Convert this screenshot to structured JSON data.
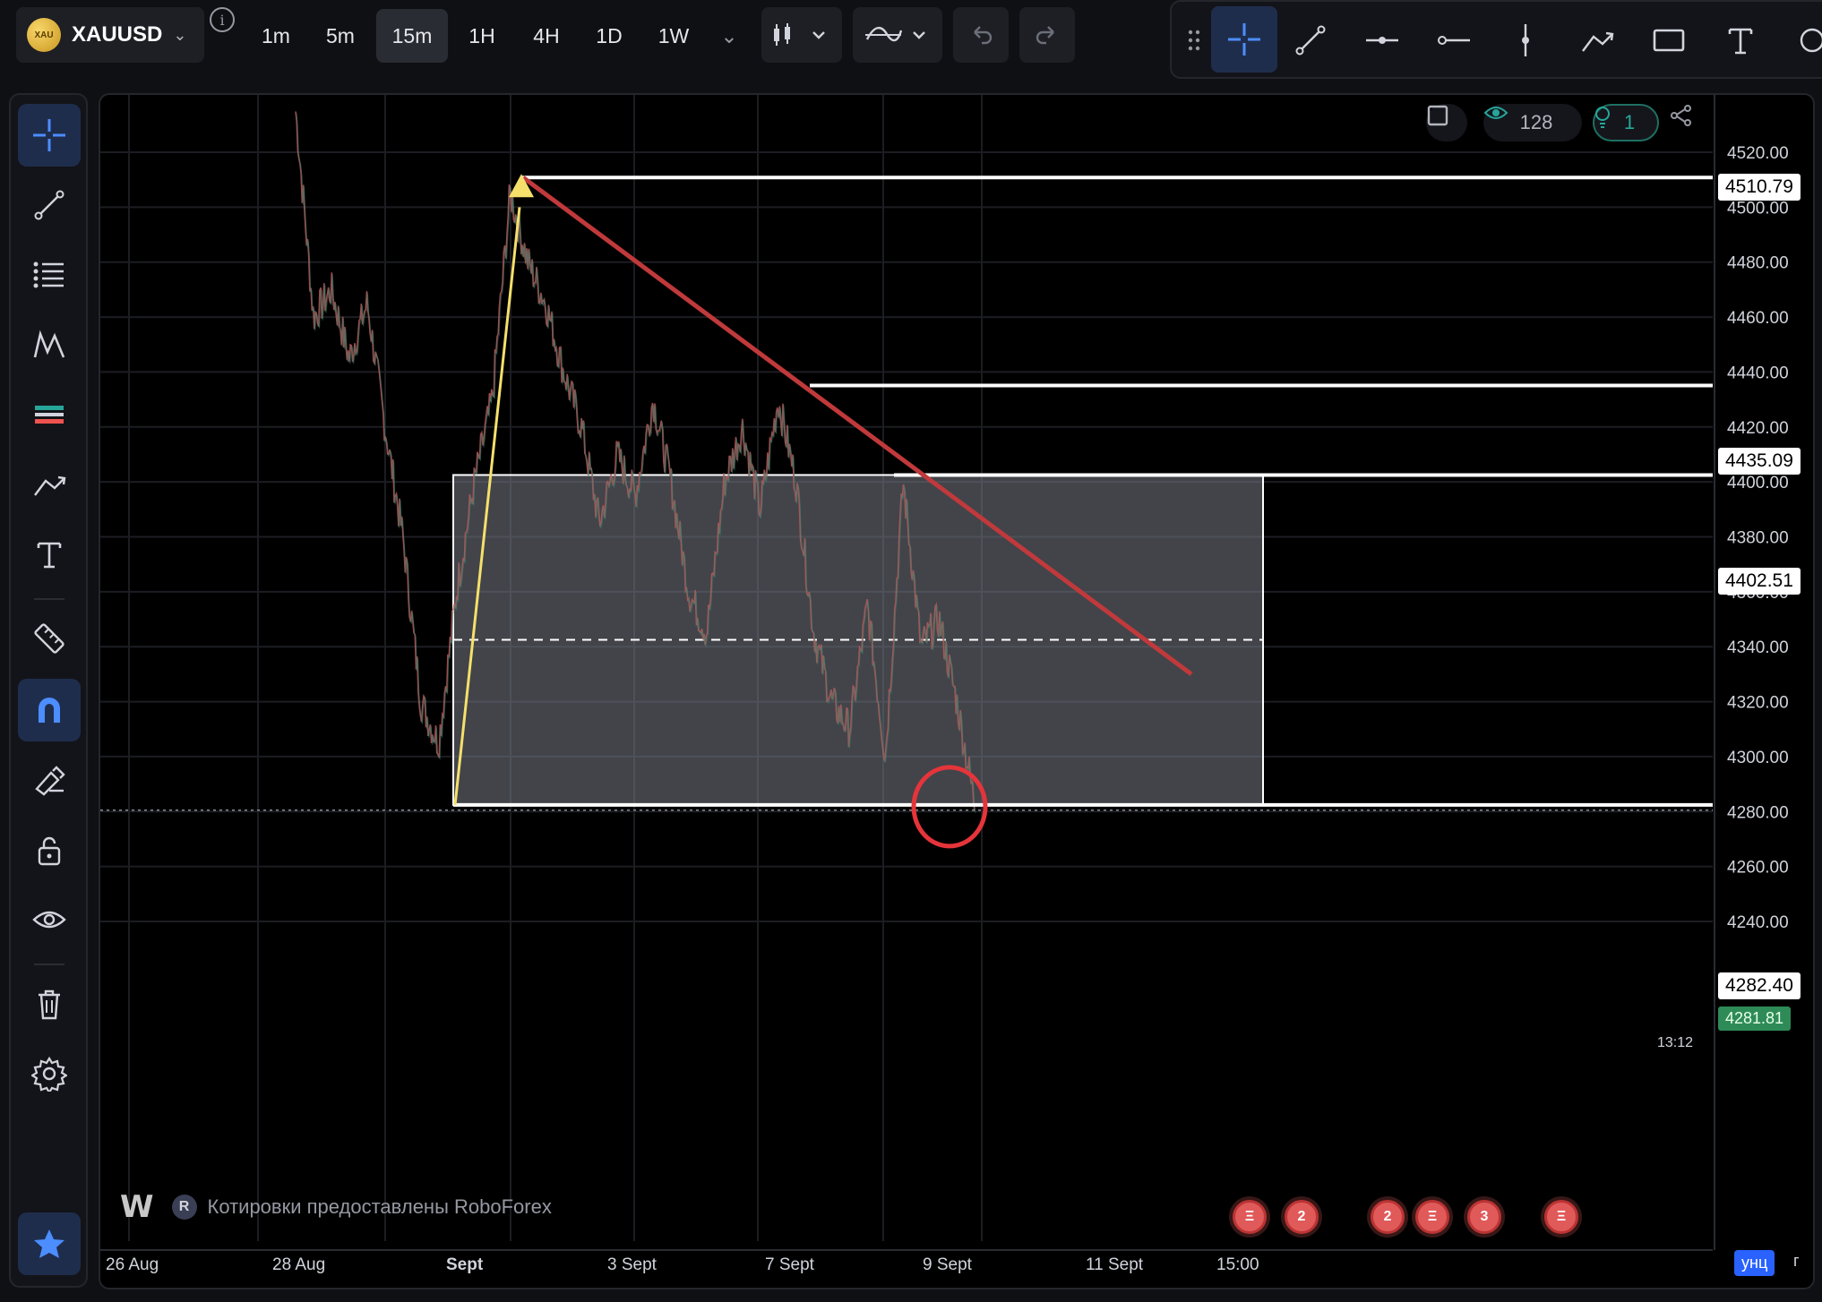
{
  "toolbar": {
    "symbol": "XAUUSD",
    "coin_text": "XAU",
    "timeframes": [
      "1m",
      "5m",
      "15m",
      "1H",
      "4H",
      "1D",
      "1W"
    ],
    "active_timeframe": "15m"
  },
  "chart_controls": {
    "views_count": "128",
    "ideas_count": "1"
  },
  "price_axis": {
    "ticks": [
      "4520.00",
      "4500.00",
      "4480.00",
      "4460.00",
      "4440.00",
      "4420.00",
      "4400.00",
      "4380.00",
      "4360.00",
      "4340.00",
      "4320.00",
      "4300.00",
      "4280.00",
      "4260.00",
      "4240.00"
    ],
    "level_labels": [
      "4510.79",
      "4435.09",
      "4402.51",
      "4282.40"
    ],
    "current_price": "4281.81",
    "countdown": "13:12"
  },
  "time_axis": {
    "labels": [
      "26 Aug",
      "28 Aug",
      "Sept",
      "3 Sept",
      "7 Sept",
      "9 Sept",
      "11 Sept",
      "15:00"
    ]
  },
  "watermark": {
    "logo": "W",
    "provider_badge": "R",
    "text": "Котировки предоставлены RoboForex"
  },
  "events": {
    "badges": [
      "2",
      "2",
      "2",
      "3"
    ]
  },
  "status": {
    "lang_active": "унц",
    "lang_rest": "г"
  },
  "colors": {
    "accent": "#2962ff",
    "trendline": "#c0393b",
    "arrow": "#f5e06b",
    "level": "#ffffff",
    "marker_circle": "#e5343a",
    "current_price_bg": "#2e8b57"
  },
  "chart_data": {
    "type": "line",
    "title": "XAUUSD 15m",
    "x": [
      "26 Aug",
      "28 Aug",
      "Sept",
      "3 Sept",
      "7 Sept",
      "9 Sept",
      "11 Sept",
      "15:00"
    ],
    "series": [
      {
        "values": [
          4535,
          4460,
          4470,
          4445,
          4465,
          4420,
          4380,
          4320,
          4305,
          4360,
          4400,
          4430,
          4505,
          4480,
          4465,
          4440,
          4420,
          4385,
          4410,
          4395,
          4430,
          4400,
          4360,
          4345,
          4400,
          4420,
          4390,
          4430,
          4400,
          4345,
          4320,
          4310,
          4355,
          4300,
          4400,
          4340,
          4350,
          4320,
          4283
        ]
      }
    ],
    "levels": [
      4510.79,
      4435.09,
      4402.51,
      4282.4
    ],
    "range_box": {
      "top": 4402.51,
      "bottom": 4282.4,
      "mid": 4342.5
    },
    "ylim": [
      4220,
      4535
    ]
  }
}
